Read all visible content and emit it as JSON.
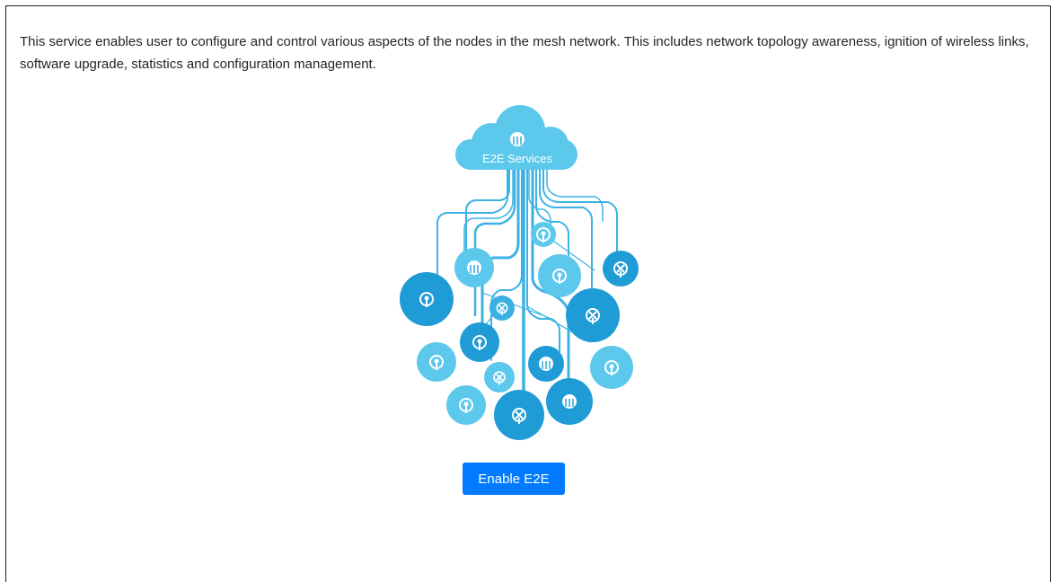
{
  "description": "This service enables user to configure and control various aspects of the nodes in the mesh network. This includes network topology awareness, ignition of wireless links, software upgrade, statistics and configuration management.",
  "illustration": {
    "cloud_label": "E2E Services",
    "colors": {
      "light": "#5bc8ec",
      "medium": "#3bb0e2",
      "dark": "#1f9bd6",
      "line": "#3cb2e4"
    },
    "icons": [
      "antenna-icon",
      "router-icon",
      "hub-icon"
    ]
  },
  "actions": {
    "enable_label": "Enable E2E"
  }
}
